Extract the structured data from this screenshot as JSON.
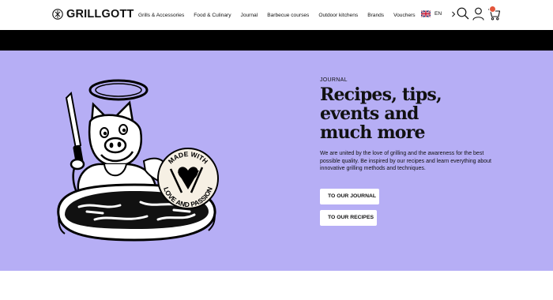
{
  "header": {
    "logo_text": "GRILLGOTT",
    "nav": [
      "Grills & Accessories",
      "Food & Culinary",
      "Journal",
      "Barbecue courses",
      "Outdoor kitchens",
      "Brands",
      "Vouchers"
    ],
    "language": "EN",
    "icons": [
      "grillgott-logo-icon",
      "uk-flag-icon",
      "chevron-right-icon",
      "search-icon",
      "account-icon",
      "cart-icon"
    ]
  },
  "hero": {
    "eyebrow": "JOURNAL",
    "title_line1": "Recipes, tips, events and",
    "title_line2": "much more",
    "description": "We are united by the love of grilling and the awareness for the best possible quality. Be inspired by our recipes and learn everything about innovative grilling methods and techniques.",
    "buttons": {
      "journal": "TO OUR JOURNAL",
      "recipes": "TO OUR RECIPES"
    },
    "badge_text": "MADE WITH LOVE AND PASSION",
    "badge_top": "MADE WITH",
    "badge_bottom": "LOVE AND PASSION",
    "background": "#b6aef5"
  },
  "colors": {
    "accent": "#b6aef5",
    "cart_badge": "#e3553b",
    "strip": "#000000"
  }
}
